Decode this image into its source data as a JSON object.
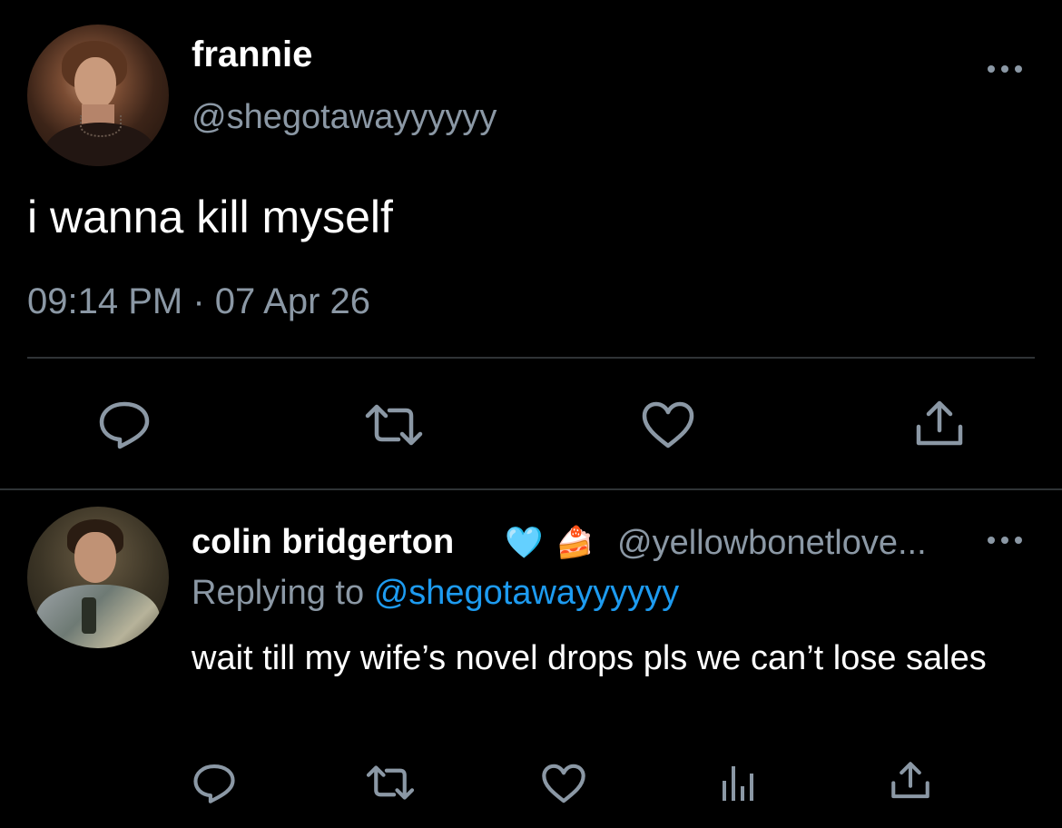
{
  "main_tweet": {
    "display_name": "frannie",
    "handle": "@shegotawayyyyyy",
    "text": "i wanna kill myself",
    "timestamp": "09:14 PM · 07 Apr 26",
    "actions": [
      "reply-icon",
      "retweet-icon",
      "like-icon",
      "share-icon"
    ]
  },
  "reply_tweet": {
    "display_name": "colin bridgerton",
    "emojis": [
      "🩵",
      "🍰"
    ],
    "handle": "@yellowbonetlove...",
    "replying_label": "Replying to",
    "replying_handle": "@shegotawayyyyyy",
    "text": "wait till my wife’s novel drops pls we can’t lose sales",
    "actions": [
      "reply-icon",
      "retweet-icon",
      "like-icon",
      "analytics-icon",
      "share-icon"
    ]
  },
  "colors": {
    "background": "#000000",
    "primary_text": "#ffffff",
    "secondary_text": "#8b98a5",
    "link": "#1d9bf0",
    "divider": "#2f3336"
  }
}
